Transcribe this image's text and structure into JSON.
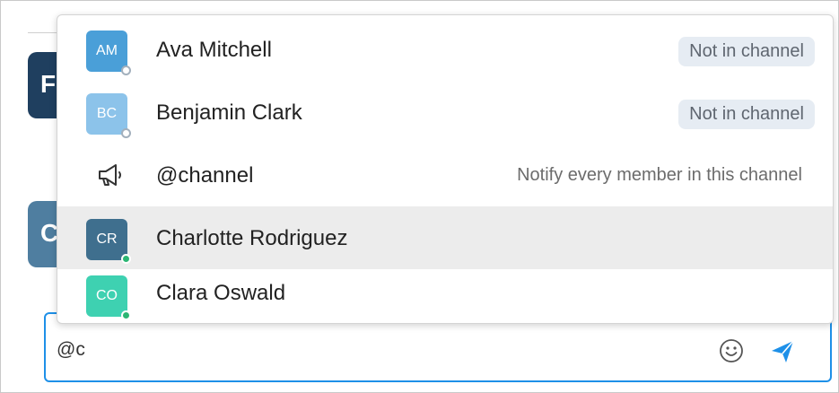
{
  "background": {
    "avatar_1_letter": "F",
    "avatar_2_letter": "C"
  },
  "mention_popup": {
    "items": [
      {
        "initials": "AM",
        "name": "Ava Mitchell",
        "badge": "Not in channel",
        "avatar_color": "#4a9fd8",
        "presence": "away"
      },
      {
        "initials": "BC",
        "name": "Benjamin Clark",
        "badge": "Not in channel",
        "avatar_color": "#8cc3ea",
        "presence": "away"
      },
      {
        "icon": "megaphone-icon",
        "name": "@channel",
        "note": "Notify every member in this channel"
      },
      {
        "initials": "CR",
        "name": "Charlotte Rodriguez",
        "avatar_color": "#3f6f8e",
        "presence": "online",
        "selected": true
      },
      {
        "initials": "CO",
        "name": "Clara Oswald",
        "avatar_color": "#3ed1b1",
        "presence": "online"
      }
    ]
  },
  "composer": {
    "value": "@c",
    "emoji_icon": "smiley-icon",
    "send_icon": "send-icon"
  },
  "colors": {
    "accent": "#1e90e8",
    "selected_row": "#ececec",
    "badge_bg": "#e6ecf3",
    "online": "#2bb673"
  }
}
